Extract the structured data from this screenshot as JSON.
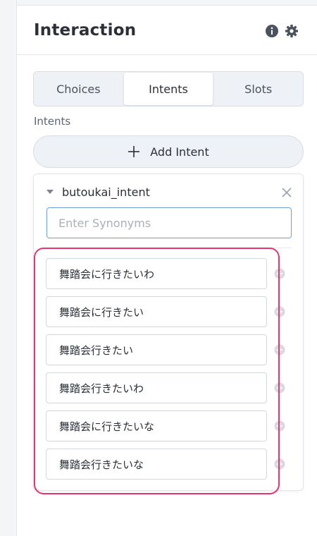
{
  "panel": {
    "title": "Interaction"
  },
  "tabs": [
    {
      "label": "Choices",
      "active": false
    },
    {
      "label": "Intents",
      "active": true
    },
    {
      "label": "Slots",
      "active": false
    }
  ],
  "intents_section": {
    "label": "Intents",
    "add_button_label": "Add Intent"
  },
  "intent_card": {
    "name": "butoukai_intent",
    "synonym_input_placeholder": "Enter Synonyms",
    "synonyms": [
      "舞踏会に行きたいわ",
      "舞踏会に行きたい",
      "舞踏会行きたい",
      "舞踏会行きたいわ",
      "舞踏会に行きたいな",
      "舞踏会行きたいな"
    ]
  },
  "icons": {
    "header": [
      "info-icon",
      "gear-icon"
    ],
    "add": "plus-icon",
    "card": [
      "caret-down-icon",
      "close-icon"
    ],
    "synonym_action": "add-circle-icon"
  },
  "colors": {
    "highlight": "#e8336f",
    "input_focus": "#6b9fd9",
    "header_icon": "#4a525e"
  }
}
